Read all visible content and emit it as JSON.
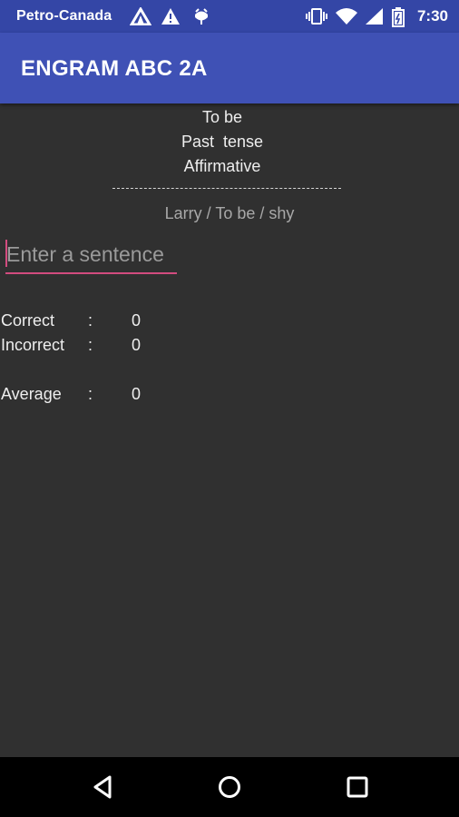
{
  "status_bar": {
    "carrier": "Petro-Canada",
    "time": "7:30",
    "icons": [
      "signal-tower-icon",
      "warning-icon",
      "android-debug-icon",
      "vibrate-icon",
      "wifi-icon",
      "cell-signal-icon",
      "battery-icon"
    ]
  },
  "app_bar": {
    "title": "ENGRAM ABC 2A"
  },
  "exercise": {
    "verb": "To be",
    "tense": "Past  tense",
    "form": "Affirmative",
    "prompt": "Larry / To be / shy"
  },
  "input": {
    "placeholder": "Enter a sentence",
    "value": ""
  },
  "stats": [
    {
      "label": "Correct",
      "colon": ":",
      "value": "0"
    },
    {
      "label": "Incorrect",
      "colon": ":",
      "value": "0"
    },
    {
      "label": "Average",
      "colon": ":",
      "value": "0"
    }
  ],
  "nav_bar": {
    "buttons": [
      "back-icon",
      "home-icon",
      "recents-icon"
    ]
  },
  "colors": {
    "status_bar": "#3446a6",
    "app_bar": "#3f51b5",
    "background": "#303030",
    "accent": "#d24c7f",
    "nav_bar": "#000000"
  }
}
